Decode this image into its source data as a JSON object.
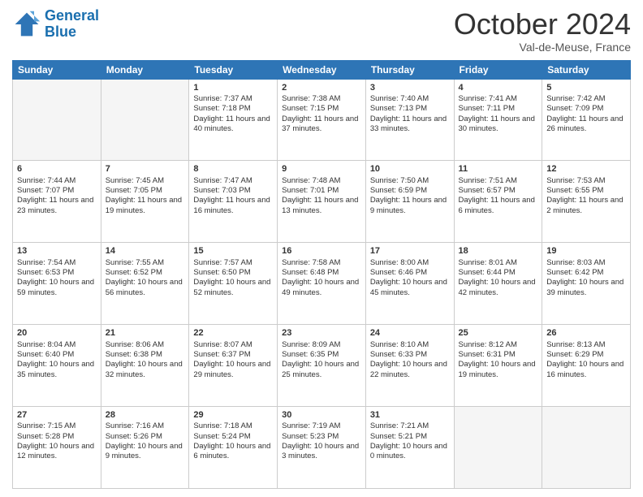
{
  "header": {
    "logo_line1": "General",
    "logo_line2": "Blue",
    "month": "October 2024",
    "location": "Val-de-Meuse, France"
  },
  "weekdays": [
    "Sunday",
    "Monday",
    "Tuesday",
    "Wednesday",
    "Thursday",
    "Friday",
    "Saturday"
  ],
  "weeks": [
    [
      {
        "day": "",
        "empty": true
      },
      {
        "day": "",
        "empty": true
      },
      {
        "day": "1",
        "sunrise": "Sunrise: 7:37 AM",
        "sunset": "Sunset: 7:18 PM",
        "daylight": "Daylight: 11 hours and 40 minutes."
      },
      {
        "day": "2",
        "sunrise": "Sunrise: 7:38 AM",
        "sunset": "Sunset: 7:15 PM",
        "daylight": "Daylight: 11 hours and 37 minutes."
      },
      {
        "day": "3",
        "sunrise": "Sunrise: 7:40 AM",
        "sunset": "Sunset: 7:13 PM",
        "daylight": "Daylight: 11 hours and 33 minutes."
      },
      {
        "day": "4",
        "sunrise": "Sunrise: 7:41 AM",
        "sunset": "Sunset: 7:11 PM",
        "daylight": "Daylight: 11 hours and 30 minutes."
      },
      {
        "day": "5",
        "sunrise": "Sunrise: 7:42 AM",
        "sunset": "Sunset: 7:09 PM",
        "daylight": "Daylight: 11 hours and 26 minutes."
      }
    ],
    [
      {
        "day": "6",
        "sunrise": "Sunrise: 7:44 AM",
        "sunset": "Sunset: 7:07 PM",
        "daylight": "Daylight: 11 hours and 23 minutes."
      },
      {
        "day": "7",
        "sunrise": "Sunrise: 7:45 AM",
        "sunset": "Sunset: 7:05 PM",
        "daylight": "Daylight: 11 hours and 19 minutes."
      },
      {
        "day": "8",
        "sunrise": "Sunrise: 7:47 AM",
        "sunset": "Sunset: 7:03 PM",
        "daylight": "Daylight: 11 hours and 16 minutes."
      },
      {
        "day": "9",
        "sunrise": "Sunrise: 7:48 AM",
        "sunset": "Sunset: 7:01 PM",
        "daylight": "Daylight: 11 hours and 13 minutes."
      },
      {
        "day": "10",
        "sunrise": "Sunrise: 7:50 AM",
        "sunset": "Sunset: 6:59 PM",
        "daylight": "Daylight: 11 hours and 9 minutes."
      },
      {
        "day": "11",
        "sunrise": "Sunrise: 7:51 AM",
        "sunset": "Sunset: 6:57 PM",
        "daylight": "Daylight: 11 hours and 6 minutes."
      },
      {
        "day": "12",
        "sunrise": "Sunrise: 7:53 AM",
        "sunset": "Sunset: 6:55 PM",
        "daylight": "Daylight: 11 hours and 2 minutes."
      }
    ],
    [
      {
        "day": "13",
        "sunrise": "Sunrise: 7:54 AM",
        "sunset": "Sunset: 6:53 PM",
        "daylight": "Daylight: 10 hours and 59 minutes."
      },
      {
        "day": "14",
        "sunrise": "Sunrise: 7:55 AM",
        "sunset": "Sunset: 6:52 PM",
        "daylight": "Daylight: 10 hours and 56 minutes."
      },
      {
        "day": "15",
        "sunrise": "Sunrise: 7:57 AM",
        "sunset": "Sunset: 6:50 PM",
        "daylight": "Daylight: 10 hours and 52 minutes."
      },
      {
        "day": "16",
        "sunrise": "Sunrise: 7:58 AM",
        "sunset": "Sunset: 6:48 PM",
        "daylight": "Daylight: 10 hours and 49 minutes."
      },
      {
        "day": "17",
        "sunrise": "Sunrise: 8:00 AM",
        "sunset": "Sunset: 6:46 PM",
        "daylight": "Daylight: 10 hours and 45 minutes."
      },
      {
        "day": "18",
        "sunrise": "Sunrise: 8:01 AM",
        "sunset": "Sunset: 6:44 PM",
        "daylight": "Daylight: 10 hours and 42 minutes."
      },
      {
        "day": "19",
        "sunrise": "Sunrise: 8:03 AM",
        "sunset": "Sunset: 6:42 PM",
        "daylight": "Daylight: 10 hours and 39 minutes."
      }
    ],
    [
      {
        "day": "20",
        "sunrise": "Sunrise: 8:04 AM",
        "sunset": "Sunset: 6:40 PM",
        "daylight": "Daylight: 10 hours and 35 minutes."
      },
      {
        "day": "21",
        "sunrise": "Sunrise: 8:06 AM",
        "sunset": "Sunset: 6:38 PM",
        "daylight": "Daylight: 10 hours and 32 minutes."
      },
      {
        "day": "22",
        "sunrise": "Sunrise: 8:07 AM",
        "sunset": "Sunset: 6:37 PM",
        "daylight": "Daylight: 10 hours and 29 minutes."
      },
      {
        "day": "23",
        "sunrise": "Sunrise: 8:09 AM",
        "sunset": "Sunset: 6:35 PM",
        "daylight": "Daylight: 10 hours and 25 minutes."
      },
      {
        "day": "24",
        "sunrise": "Sunrise: 8:10 AM",
        "sunset": "Sunset: 6:33 PM",
        "daylight": "Daylight: 10 hours and 22 minutes."
      },
      {
        "day": "25",
        "sunrise": "Sunrise: 8:12 AM",
        "sunset": "Sunset: 6:31 PM",
        "daylight": "Daylight: 10 hours and 19 minutes."
      },
      {
        "day": "26",
        "sunrise": "Sunrise: 8:13 AM",
        "sunset": "Sunset: 6:29 PM",
        "daylight": "Daylight: 10 hours and 16 minutes."
      }
    ],
    [
      {
        "day": "27",
        "sunrise": "Sunrise: 7:15 AM",
        "sunset": "Sunset: 5:28 PM",
        "daylight": "Daylight: 10 hours and 12 minutes."
      },
      {
        "day": "28",
        "sunrise": "Sunrise: 7:16 AM",
        "sunset": "Sunset: 5:26 PM",
        "daylight": "Daylight: 10 hours and 9 minutes."
      },
      {
        "day": "29",
        "sunrise": "Sunrise: 7:18 AM",
        "sunset": "Sunset: 5:24 PM",
        "daylight": "Daylight: 10 hours and 6 minutes."
      },
      {
        "day": "30",
        "sunrise": "Sunrise: 7:19 AM",
        "sunset": "Sunset: 5:23 PM",
        "daylight": "Daylight: 10 hours and 3 minutes."
      },
      {
        "day": "31",
        "sunrise": "Sunrise: 7:21 AM",
        "sunset": "Sunset: 5:21 PM",
        "daylight": "Daylight: 10 hours and 0 minutes."
      },
      {
        "day": "",
        "empty": true
      },
      {
        "day": "",
        "empty": true
      }
    ]
  ]
}
